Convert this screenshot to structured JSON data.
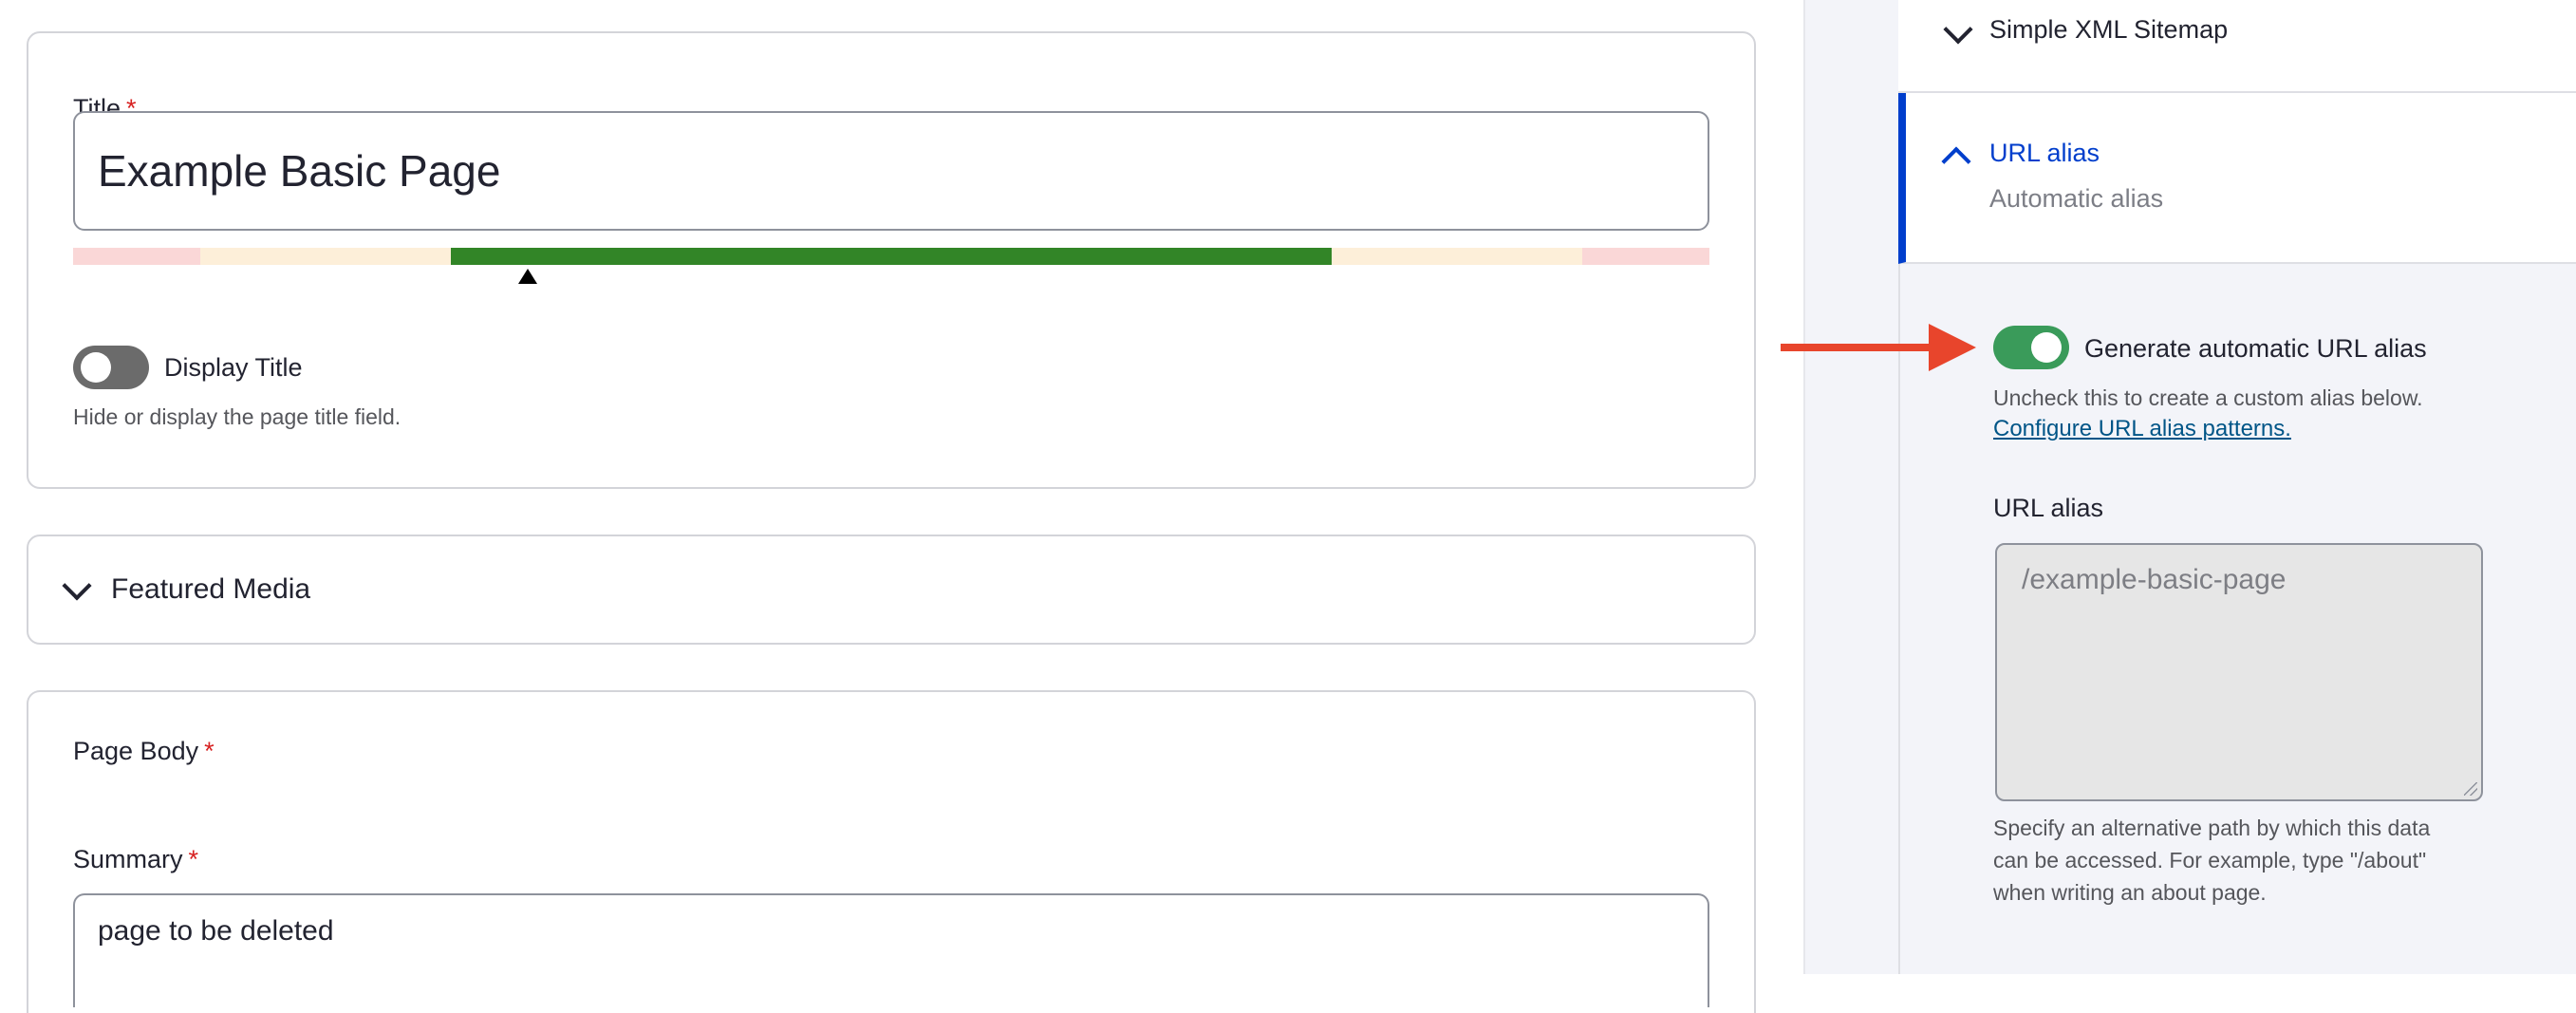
{
  "title_field": {
    "label": "Title",
    "required_mark": "*",
    "value": "Example Basic Page"
  },
  "display_title": {
    "label": "Display Title",
    "enabled": false,
    "description": "Hide or display the page title field."
  },
  "featured_media": {
    "label": "Featured Media"
  },
  "page_body": {
    "label": "Page Body",
    "required_mark": "*"
  },
  "summary": {
    "label": "Summary",
    "required_mark": "*",
    "value": "page to be deleted"
  },
  "sidebar": {
    "sitemap": {
      "label": "Simple XML Sitemap"
    },
    "url_alias_section": {
      "label": "URL alias",
      "summary": "Automatic alias"
    },
    "generate_alias": {
      "label": "Generate automatic URL alias",
      "enabled": true,
      "description": "Uncheck this to create a custom alias below.",
      "link": "Configure URL alias patterns."
    },
    "alias_field": {
      "label": "URL alias",
      "placeholder": "/example-basic-page",
      "description_lines": [
        "Specify an alternative path by which this data",
        "can be accessed. For example, type \"/about\"",
        "when writing an about page."
      ]
    }
  },
  "colors": {
    "accent": "#003ecc",
    "toggle_on": "#3a9b5a",
    "toggle_off": "#6b6b6b",
    "meter_good": "#328527",
    "arrow": "#e8452c",
    "required": "#d72222"
  }
}
